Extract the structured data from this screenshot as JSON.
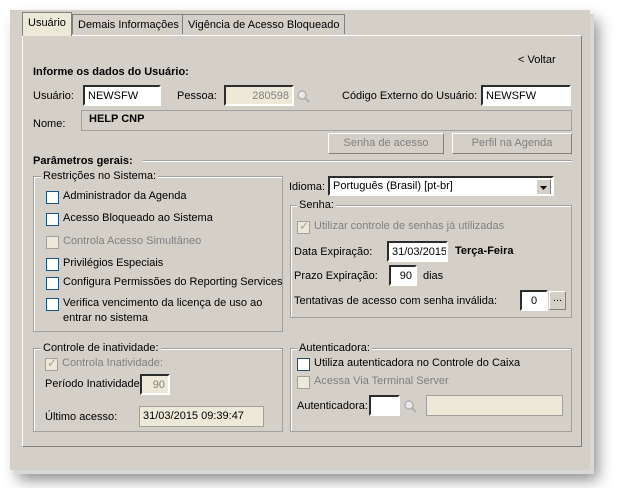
{
  "tabs": [
    "Usuário",
    "Demais Informações",
    "Vigência de Acesso Bloqueado"
  ],
  "voltar_label": "< Voltar",
  "section_user_title": "Informe os dados do Usuário:",
  "user": {
    "usuario_label": "Usuário:",
    "usuario_value": "NEWSFW",
    "pessoa_label": "Pessoa:",
    "pessoa_value": "280598",
    "codigo_label": "Código Externo do Usuário:",
    "codigo_value": "NEWSFW",
    "nome_label": "Nome:",
    "nome_value": "HELP CNP"
  },
  "buttons": {
    "senha": "Senha de acesso",
    "perfil": "Perfil na Agenda"
  },
  "section_params_title": "Parâmetros gerais:",
  "restricoes": {
    "title": "Restrições no Sistema:",
    "items": [
      "Administrador da Agenda",
      "Acesso Bloqueado ao Sistema",
      "Controla Acesso Simultâneo",
      "Privilégios Especiais",
      "Configura Permissões do Reporting Services",
      "Verifica vencimento da licença de uso ao",
      "entrar no sistema"
    ]
  },
  "idioma": {
    "label": "Idioma:",
    "value": "Português (Brasil) [pt-br]"
  },
  "senha": {
    "title": "Senha:",
    "controle_label": "Utilizar controle de senhas já utilizadas",
    "data_label": "Data Expiração:",
    "data_value": "31/03/2015",
    "dia_semana": "Terça-Feira",
    "prazo_label": "Prazo Expiração:",
    "prazo_value": "90",
    "prazo_unit": "dias",
    "tentativas_label": "Tentativas de acesso com senha inválida:",
    "tentativas_value": "0",
    "ellipsis": "..."
  },
  "inatividade": {
    "title": "Controle de inatividade:",
    "controla_label": "Controla Inatividade:",
    "periodo_label": "Período Inatividade:",
    "periodo_value": "90",
    "ultimo_label": "Último acesso:",
    "ultimo_value": "31/03/2015 09:39:47"
  },
  "autenticadora": {
    "title": "Autenticadora:",
    "utiliza_label": "Utiliza autenticadora no Controle do Caixa",
    "acessa_label": "Acessa Via Terminal Server",
    "field_label": "Autenticadora:"
  }
}
